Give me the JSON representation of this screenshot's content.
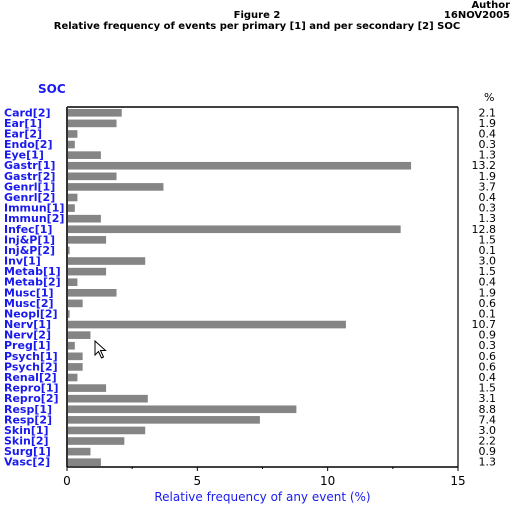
{
  "header": {
    "author": "Author",
    "date": "16NOV2005",
    "title": "Figure 2",
    "subtitle": "Relative frequency of events per primary [1] and per secondary [2] SOC"
  },
  "colors": {
    "label_blue": "#1a1aee",
    "bar_gray": "#858585",
    "axis_black": "#000000"
  },
  "chart_data": {
    "type": "bar",
    "orientation": "horizontal",
    "title": "Figure 2",
    "subtitle": "Relative frequency of events per primary [1] and per secondary [2] SOC",
    "ylabel": "SOC",
    "xlabel": "Relative frequency of any event (%)",
    "value_column_label": "%",
    "xlim": [
      0,
      15
    ],
    "xticks": [
      0,
      5,
      10,
      15
    ],
    "minor_ticks": [
      2.5,
      7.5,
      12.5
    ],
    "grid": false,
    "categories": [
      "Card[2]",
      "Ear[1]",
      "Ear[2]",
      "Endo[2]",
      "Eye[1]",
      "Gastr[1]",
      "Gastr[2]",
      "Genrl[1]",
      "Genrl[2]",
      "Immun[1]",
      "Immun[2]",
      "Infec[1]",
      "Inj&P[1]",
      "Inj&P[2]",
      "Inv[1]",
      "Metab[1]",
      "Metab[2]",
      "Musc[1]",
      "Musc[2]",
      "Neopl[2]",
      "Nerv[1]",
      "Nerv[2]",
      "Preg[1]",
      "Psych[1]",
      "Psych[2]",
      "Renal[2]",
      "Repro[1]",
      "Repro[2]",
      "Resp[1]",
      "Resp[2]",
      "Skin[1]",
      "Skin[2]",
      "Surg[1]",
      "Vasc[2]"
    ],
    "values": [
      2.1,
      1.9,
      0.4,
      0.3,
      1.3,
      13.2,
      1.9,
      3.7,
      0.4,
      0.3,
      1.3,
      12.8,
      1.5,
      0.1,
      3.0,
      1.5,
      0.4,
      1.9,
      0.6,
      0.1,
      10.7,
      0.9,
      0.3,
      0.6,
      0.6,
      0.4,
      1.5,
      3.1,
      8.8,
      7.4,
      3.0,
      2.2,
      0.9,
      1.3
    ],
    "value_labels": [
      "2.1",
      "1.9",
      "0.4",
      "0.3",
      "1.3",
      "13.2",
      "1.9",
      "3.7",
      "0.4",
      "0.3",
      "1.3",
      "12.8",
      "1.5",
      "0.1",
      "3.0",
      "1.5",
      "0.4",
      "1.9",
      "0.6",
      "0.1",
      "10.7",
      "0.9",
      "0.3",
      "0.6",
      "0.6",
      "0.4",
      "1.5",
      "3.1",
      "8.8",
      "7.4",
      "3.0",
      "2.2",
      "0.9",
      "1.3"
    ]
  },
  "labels": {
    "soc": "SOC",
    "pct": "%"
  }
}
